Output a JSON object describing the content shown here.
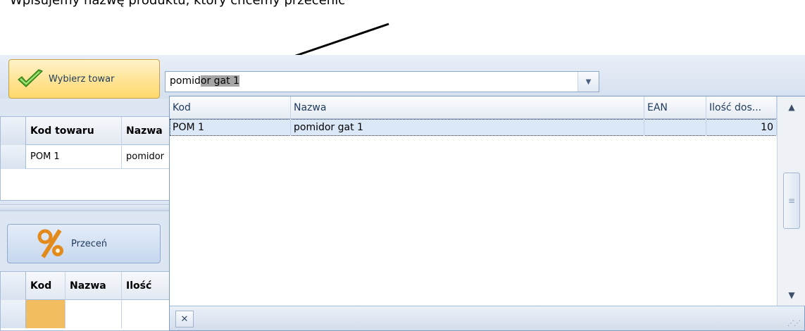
{
  "annotation": {
    "top_text": "Wpisujemy nazwę produktu, który chcemy przecenić"
  },
  "toolbar": {
    "select_button_label": "Wybierz towar",
    "select_button_icon": "checkmark-icon",
    "discount_button_label": "Przeceń",
    "discount_button_icon": "percent-icon"
  },
  "search": {
    "typed": "pomid",
    "autocomplete": "or gat 1"
  },
  "products_grid": {
    "columns": [
      "Kod towaru",
      "Nazwa"
    ],
    "rows": [
      {
        "kod": "POM 1",
        "nazwa": "pomidor"
      }
    ]
  },
  "discount_grid": {
    "columns": [
      "Kod",
      "Nazwa",
      "Ilość"
    ]
  },
  "dropdown": {
    "columns": [
      "Kod",
      "Nazwa",
      "EAN",
      "Ilość dos..."
    ],
    "rows": [
      {
        "kod": "POM 1",
        "nazwa": "pomidor gat 1",
        "ean": "",
        "ilosc": "10"
      }
    ],
    "close_icon": "close-icon"
  },
  "colors": {
    "accent_yellow": "#ffd86b",
    "selection_orange": "#f2bd5e",
    "row_highlight": "#dbe8f8"
  }
}
